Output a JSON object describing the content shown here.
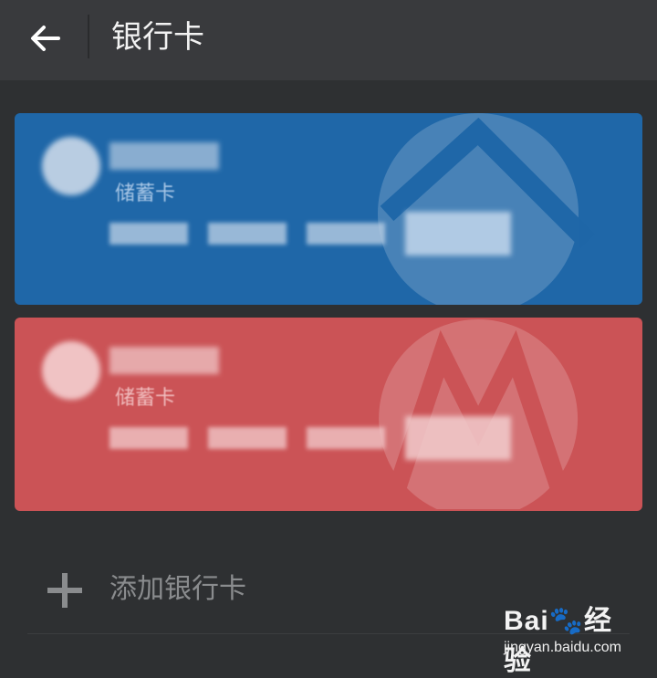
{
  "header": {
    "title": "银行卡",
    "back_icon": "arrow-left-icon"
  },
  "cards": [
    {
      "color": "#1f67a8",
      "bank_name": "",
      "card_type": "储蓄卡",
      "masked_number": "**** **** **** ****"
    },
    {
      "color": "#cb5356",
      "bank_name": "",
      "card_type": "储蓄卡",
      "masked_number": "**** **** **** ****"
    }
  ],
  "add_card": {
    "label": "添加银行卡",
    "icon": "plus-icon"
  },
  "watermark": {
    "brand": "Bai",
    "brand_suffix": "经验",
    "url": "jingyan.baidu.com"
  },
  "colors": {
    "background": "#2e3032",
    "topbar": "#393a3d",
    "blue_card": "#1f67a8",
    "red_card": "#cb5356"
  }
}
